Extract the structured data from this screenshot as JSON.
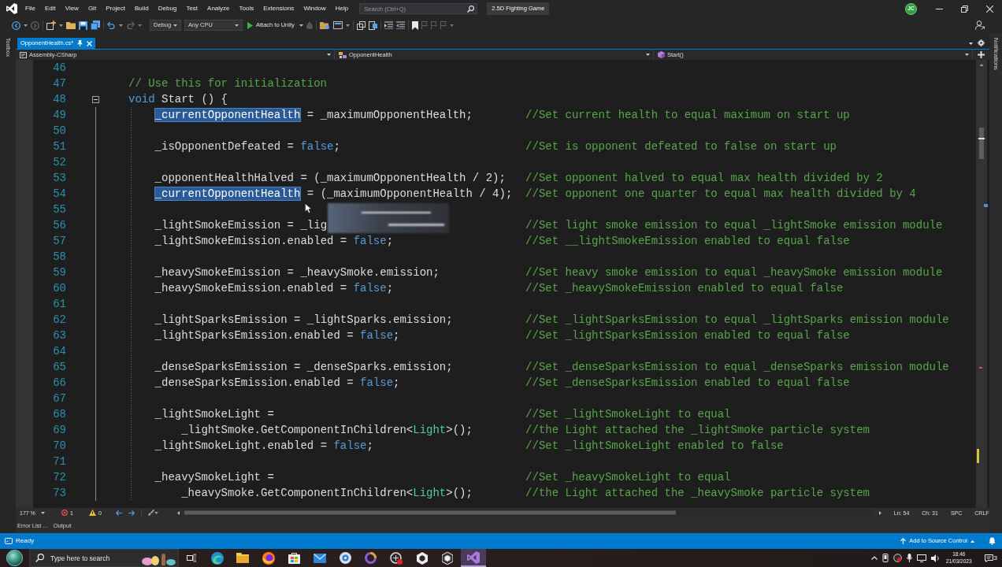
{
  "title_bar": {
    "menu": [
      "File",
      "Edit",
      "View",
      "Git",
      "Project",
      "Build",
      "Debug",
      "Test",
      "Analyze",
      "Tools",
      "Extensions",
      "Window",
      "Help"
    ],
    "search": {
      "placeholder": "Search (Ctrl+Q)"
    },
    "solution": "2.5D Fighting Game",
    "avatar_initials": "JC"
  },
  "toolbar": {
    "configuration": "Debug",
    "platform": "Any CPU",
    "run": "Attach to Unity"
  },
  "side_tabs": {
    "left": "Toolbox",
    "right": "Notifications"
  },
  "document_tabs": [
    {
      "label": "OpponentHealth.cs*",
      "selected": true
    }
  ],
  "navigation_bar": {
    "project": "Assembly-CSharp",
    "type": "OpponentHealth",
    "member": "Start()"
  },
  "editor": {
    "lines": [
      {
        "n": "46"
      },
      {
        "n": "47",
        "tokens": [
          {
            "kind": "comment",
            "text": "// Use this for initialization"
          }
        ]
      },
      {
        "n": "48",
        "expanded": true,
        "tokens": [
          {
            "kind": "keyword",
            "text": "void"
          },
          {
            "kind": "plain",
            "text": " Start () {"
          }
        ],
        "children": [
          {
            "n": "49",
            "tokens": [
              {
                "kind": "highlight",
                "text": "_currentOpponentHealth"
              },
              {
                "kind": "plain",
                "text": " = _maximumOpponentHealth;"
              }
            ],
            "comment": "//Set current health to equal maximum on start up"
          },
          {
            "n": "50"
          },
          {
            "n": "51",
            "tokens": [
              {
                "kind": "plain",
                "text": "_isOpponentDefeated = "
              },
              {
                "kind": "keyword",
                "text": "false"
              },
              {
                "kind": "plain",
                "text": ";"
              }
            ],
            "comment": "//Set is opponent defeated to false on start up"
          },
          {
            "n": "52"
          },
          {
            "n": "53",
            "tokens": [
              {
                "kind": "plain",
                "text": "_opponentHealthHalved = (_maximumOpponentHealth / 2);"
              }
            ],
            "comment": "//Set opponent halved to equal max health divided by 2"
          },
          {
            "n": "54",
            "tokens": [
              {
                "kind": "highlight",
                "text": "_currentOpponentHealth"
              },
              {
                "kind": "plain",
                "text": " = (_maximumOpponentHealth / 4);"
              }
            ],
            "comment": "//Set opponent one quarter to equal max health divided by 4"
          },
          {
            "n": "55"
          },
          {
            "n": "56",
            "tokens": [
              {
                "kind": "plain",
                "text": "_lightSmokeEmission = _lig"
              }
            ],
            "comment": "//Set light smoke emission to equal _lightSmoke emission module"
          },
          {
            "n": "57",
            "tokens": [
              {
                "kind": "plain",
                "text": "_lightSmokeEmission.enabled = "
              },
              {
                "kind": "keyword",
                "text": "false"
              },
              {
                "kind": "plain",
                "text": ";"
              }
            ],
            "comment": "//Set __lightSmokeEmission enabled to equal false"
          },
          {
            "n": "58"
          },
          {
            "n": "59",
            "tokens": [
              {
                "kind": "plain",
                "text": "_heavySmokeEmission = _heavySmoke.emission;"
              }
            ],
            "comment": "//Set heavy smoke emission to equal _heavySmoke emission module"
          },
          {
            "n": "60",
            "tokens": [
              {
                "kind": "plain",
                "text": "_heavySmokeEmission.enabled = "
              },
              {
                "kind": "keyword",
                "text": "false"
              },
              {
                "kind": "plain",
                "text": ";"
              }
            ],
            "comment": "//Set _heavySmokeEmission enabled to equal false"
          },
          {
            "n": "61"
          },
          {
            "n": "62",
            "tokens": [
              {
                "kind": "plain",
                "text": "_lightSparksEmission = _lightSparks.emission;"
              }
            ],
            "comment": "//Set _lightSparksEmission to equal _lightSparks emission module"
          },
          {
            "n": "63",
            "tokens": [
              {
                "kind": "plain",
                "text": "_lightSparksEmission.enabled = "
              },
              {
                "kind": "keyword",
                "text": "false"
              },
              {
                "kind": "plain",
                "text": ";"
              }
            ],
            "comment": "//Set _lightSparksEmission enabled to equal false"
          },
          {
            "n": "64"
          },
          {
            "n": "65",
            "tokens": [
              {
                "kind": "plain",
                "text": "_denseSparksEmission = _denseSparks.emission;"
              }
            ],
            "comment": "//Set _denseSparksEmission to equal _denseSparks emission module"
          },
          {
            "n": "66",
            "tokens": [
              {
                "kind": "plain",
                "text": "_denseSparksEmission.enabled = "
              },
              {
                "kind": "keyword",
                "text": "false"
              },
              {
                "kind": "plain",
                "text": ";"
              }
            ],
            "comment": "//Set _denseSparksEmission enabled to equal false"
          },
          {
            "n": "67"
          },
          {
            "n": "68",
            "tokens": [
              {
                "kind": "plain",
                "text": "_lightSmokeLight ="
              }
            ],
            "comment": "//Set _lightSmokeLight to equal",
            "children": [
              {
                "n": "69",
                "tokens": [
                  {
                    "kind": "plain",
                    "text": "_lightSmoke.GetComponentInChildren<"
                  },
                  {
                    "kind": "type",
                    "text": "Light"
                  },
                  {
                    "kind": "plain",
                    "text": ">();"
                  }
                ],
                "comment": "//the Light attached the _lightSmoke particle system"
              }
            ]
          },
          {
            "n": "70",
            "tokens": [
              {
                "kind": "plain",
                "text": "_lightSmokeLight.enabled = "
              },
              {
                "kind": "keyword",
                "text": "false"
              },
              {
                "kind": "plain",
                "text": ";"
              }
            ],
            "comment": "//Set _lightSmokeLight enabled to false"
          },
          {
            "n": "71"
          },
          {
            "n": "72",
            "tokens": [
              {
                "kind": "plain",
                "text": "_heavySmokeLight ="
              }
            ],
            "comment": "//Set _heavySmokeLight to equal",
            "children": [
              {
                "n": "73",
                "tokens": [
                  {
                    "kind": "plain",
                    "text": "_heavySmoke.GetComponentInChildren<"
                  },
                  {
                    "kind": "type",
                    "text": "Light"
                  },
                  {
                    "kind": "plain",
                    "text": ">();"
                  }
                ],
                "comment": "//the Light attached the _heavySmoke particle system"
              }
            ]
          }
        ]
      }
    ]
  },
  "editor_status": {
    "zoom": "177 %",
    "errors": "1",
    "warnings": "0",
    "line": "Ln: 54",
    "column": "Ch: 31",
    "whitespace": "SPC",
    "line_ending": "CRLF"
  },
  "tool_tabs": [
    "Error List ...",
    "Output"
  ],
  "status_bar": {
    "text": "Ready",
    "source_control": "Add to Source Control"
  },
  "taskbar": {
    "search": {
      "placeholder": "Type here to search"
    },
    "time": "18:46",
    "date": "21/03/2023",
    "notifications": "3"
  }
}
